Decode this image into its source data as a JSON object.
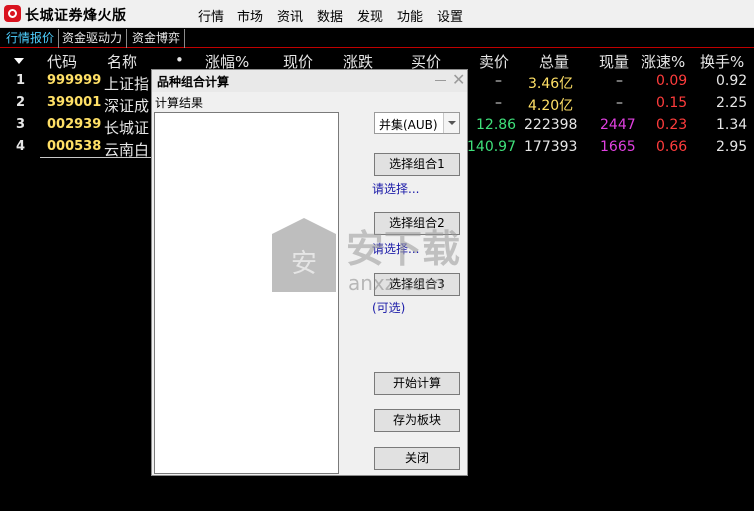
{
  "app": {
    "title": "长城证券烽火版",
    "menu": [
      "行情",
      "市场",
      "资讯",
      "数据",
      "发现",
      "功能",
      "设置"
    ]
  },
  "tabs": [
    "行情报价",
    "资金驱动力",
    "资金博弈"
  ],
  "table": {
    "columns": [
      "代码",
      "名称",
      "•",
      "涨幅%",
      "现价",
      "涨跌",
      "买价",
      "卖价",
      "总量",
      "现量",
      "涨速%",
      "换手%"
    ],
    "rows": [
      {
        "idx": "1",
        "code": "999999",
        "name": "上证指",
        "ask": "–",
        "volume": "3.46亿",
        "cur_vol": "–",
        "speed": "0.09",
        "turnover": "0.92"
      },
      {
        "idx": "2",
        "code": "399001",
        "name": "深证成",
        "ask": "–",
        "volume": "4.20亿",
        "cur_vol": "–",
        "speed": "0.15",
        "turnover": "2.25"
      },
      {
        "idx": "3",
        "code": "002939",
        "name": "长城证",
        "ask": "12.86",
        "volume": "222398",
        "cur_vol": "2447",
        "speed": "0.23",
        "turnover": "1.34"
      },
      {
        "idx": "4",
        "code": "000538",
        "name": "云南白",
        "ask": "140.97",
        "volume": "177393",
        "cur_vol": "1665",
        "speed": "0.66",
        "turnover": "2.95"
      }
    ]
  },
  "dialog": {
    "title": "品种组合计算",
    "result_label": "计算结果",
    "combo_value": "并集(AUB)",
    "btn_select1": "选择组合1",
    "hint1": "请选择...",
    "btn_select2": "选择组合2",
    "hint2": "请选择...",
    "btn_select3": "选择组合3",
    "hint3": "(可选)",
    "btn_start": "开始计算",
    "btn_save": "存为板块",
    "btn_close": "关闭"
  },
  "watermark": {
    "logo_char": "安",
    "main_text": "安下载",
    "sub_text": "anxz.com"
  },
  "colors": {
    "background": "#000000",
    "accent_red": "#d9131f",
    "price_up": "#ff3c3c",
    "price_green": "#3fe07a",
    "code_yellow": "#ffe066",
    "cur_vol_magenta": "#e040e0",
    "active_tab": "#4fd0ff"
  }
}
